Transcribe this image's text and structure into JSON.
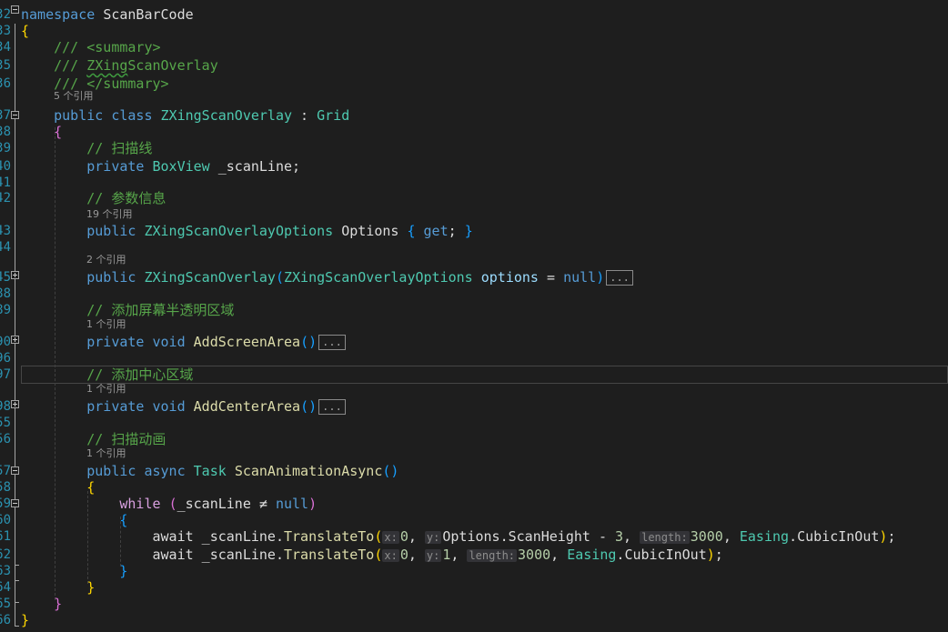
{
  "colors": {
    "background": "#1e1e1e",
    "line_number": "#2b91af",
    "keyword": "#569cd6",
    "control": "#d8a0df",
    "type": "#4ec9b0",
    "method": "#dcdcaa",
    "comment": "#57a64a",
    "plain": "#dcdcdc",
    "variable": "#9cdcfe",
    "number": "#b5cea8",
    "brace1": "#ffd700",
    "brace2": "#da70d6",
    "brace3": "#179fff",
    "hint": "#999999"
  },
  "line_numbers": [
    "32",
    "33",
    "34",
    "35",
    "36",
    "37",
    "38",
    "39",
    "40",
    "41",
    "42",
    "43",
    "44",
    "45",
    "88",
    "89",
    "90",
    "96",
    "97",
    "98",
    "55",
    "56",
    "57",
    "58",
    "59",
    "60",
    "61",
    "62",
    "63",
    "64",
    "65",
    "66"
  ],
  "hints": [
    "5 个引用",
    "19 个引用",
    "2 个引用",
    "1 个引用",
    "1 个引用",
    "1 个引用"
  ],
  "code_lines": [
    [
      [
        "kw",
        "namespace "
      ],
      [
        "pl",
        "ScanBarCode"
      ]
    ],
    [
      [
        "b1",
        "{"
      ]
    ],
    [
      [
        "cm",
        "    /// <summary>"
      ]
    ],
    [
      [
        "cm",
        "    /// "
      ],
      [
        "cmsq",
        "ZXing"
      ],
      [
        "cm",
        "ScanOverlay"
      ]
    ],
    [
      [
        "cm",
        "    /// </summary>"
      ]
    ],
    [
      [
        "kw",
        "    public class "
      ],
      [
        "ty",
        "ZXingScanOverlay"
      ],
      [
        "pl",
        " : "
      ],
      [
        "ty",
        "Grid"
      ]
    ],
    [
      [
        "b2",
        "    {"
      ]
    ],
    [
      [
        "cm",
        "        // 扫描线"
      ]
    ],
    [
      [
        "kw",
        "        private "
      ],
      [
        "ty",
        "BoxView"
      ],
      [
        "pl",
        " _scanLine;"
      ]
    ],
    [],
    [
      [
        "cm",
        "        // 参数信息"
      ]
    ],
    [
      [
        "kw",
        "        public "
      ],
      [
        "ty",
        "ZXingScanOverlayOptions"
      ],
      [
        "pl",
        " Options "
      ],
      [
        "b3",
        "{"
      ],
      [
        "kw",
        " get"
      ],
      [
        "pl",
        "; "
      ],
      [
        "b3",
        "}"
      ]
    ],
    [],
    [
      [
        "kw",
        "        public "
      ],
      [
        "ty",
        "ZXingScanOverlay"
      ],
      [
        "b3",
        "("
      ],
      [
        "ty",
        "ZXingScanOverlayOptions"
      ],
      [
        "var",
        " options"
      ],
      [
        "pl",
        " = "
      ],
      [
        "kw",
        "null"
      ],
      [
        "b3",
        ")"
      ],
      [
        "ell",
        "..."
      ]
    ],
    [],
    [
      [
        "cm",
        "        // 添加屏幕半透明区域"
      ]
    ],
    [
      [
        "kw",
        "        private void "
      ],
      [
        "mt",
        "AddScreenArea"
      ],
      [
        "b3",
        "()"
      ],
      [
        "ell",
        "..."
      ]
    ],
    [],
    [
      [
        "cm",
        "        // 添加中心区域"
      ]
    ],
    [
      [
        "kw",
        "        private void "
      ],
      [
        "mt",
        "AddCenterArea"
      ],
      [
        "b3",
        "()"
      ],
      [
        "ell",
        "..."
      ]
    ],
    [],
    [
      [
        "cm",
        "        // 扫描动画"
      ]
    ],
    [
      [
        "kw",
        "        public async "
      ],
      [
        "ty",
        "Task"
      ],
      [
        "pl",
        " "
      ],
      [
        "mt",
        "ScanAnimationAsync"
      ],
      [
        "b3",
        "()"
      ]
    ],
    [
      [
        "b1",
        "        {"
      ]
    ],
    [
      [
        "ct",
        "            while"
      ],
      [
        "pl",
        " "
      ],
      [
        "b2",
        "("
      ],
      [
        "pl",
        "_scanLine ≠ "
      ],
      [
        "kw",
        "null"
      ],
      [
        "b2",
        ")"
      ]
    ],
    [
      [
        "b3",
        "            {"
      ]
    ],
    [
      [
        "pl",
        "                await _scanLine."
      ],
      [
        "mt",
        "TranslateTo"
      ],
      [
        "b1",
        "("
      ],
      [
        "ih",
        "x:"
      ],
      [
        "nm",
        "0"
      ],
      [
        "pl",
        ", "
      ],
      [
        "ih",
        "y:"
      ],
      [
        "pl",
        "Options.ScanHeight - "
      ],
      [
        "nm",
        "3"
      ],
      [
        "pl",
        ", "
      ],
      [
        "ih",
        "length:"
      ],
      [
        "nm",
        "3000"
      ],
      [
        "pl",
        ", "
      ],
      [
        "ty",
        "Easing"
      ],
      [
        "pl",
        "."
      ],
      [
        "pl",
        "CubicInOut"
      ],
      [
        "b1",
        ")"
      ],
      [
        "pl",
        ";"
      ]
    ],
    [
      [
        "pl",
        "                await _scanLine."
      ],
      [
        "mt",
        "TranslateTo"
      ],
      [
        "b1",
        "("
      ],
      [
        "ih",
        "x:"
      ],
      [
        "nm",
        "0"
      ],
      [
        "pl",
        ", "
      ],
      [
        "ih",
        "y:"
      ],
      [
        "nm",
        "1"
      ],
      [
        "pl",
        ", "
      ],
      [
        "ih",
        "length:"
      ],
      [
        "nm",
        "3000"
      ],
      [
        "pl",
        ", "
      ],
      [
        "ty",
        "Easing"
      ],
      [
        "pl",
        "."
      ],
      [
        "pl",
        "CubicInOut"
      ],
      [
        "b1",
        ")"
      ],
      [
        "pl",
        ";"
      ]
    ],
    [
      [
        "b3",
        "            }"
      ]
    ],
    [
      [
        "b1",
        "        }"
      ]
    ],
    [
      [
        "b2",
        "    }"
      ]
    ],
    [
      [
        "b1",
        "}"
      ]
    ]
  ]
}
